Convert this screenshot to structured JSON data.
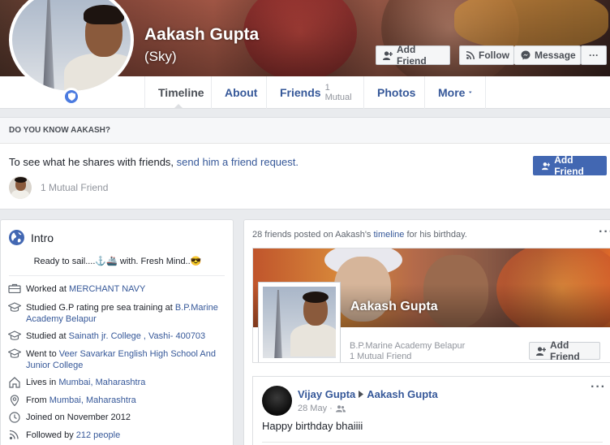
{
  "profile": {
    "name": "Aakash Gupta",
    "nickname": "(Sky)"
  },
  "header_actions": {
    "add_friend": "Add Friend",
    "follow": "Follow",
    "message": "Message",
    "more": "···"
  },
  "tabs": [
    {
      "label": "Timeline",
      "sub": ""
    },
    {
      "label": "About",
      "sub": ""
    },
    {
      "label": "Friends",
      "sub": "1 Mutual"
    },
    {
      "label": "Photos",
      "sub": ""
    },
    {
      "label": "More",
      "sub": ""
    }
  ],
  "know": {
    "header": "DO YOU KNOW AAKASH?",
    "text_prefix": "To see what he shares with friends, ",
    "text_link": "send him a friend request.",
    "add_friend": "Add Friend",
    "mutual": "1 Mutual Friend"
  },
  "intro": {
    "title": "Intro",
    "bio": "Ready to sail....⚓🚢 with. Fresh Mind..😎",
    "items": [
      {
        "prefix": "Worked at ",
        "link": "MERCHANT NAVY",
        "suffix": ""
      },
      {
        "prefix": "Studied G.P rating pre sea training at ",
        "link": "B.P.Marine Academy Belapur",
        "suffix": ""
      },
      {
        "prefix": "Studied at ",
        "link": "Sainath jr. College , Vashi- 400703",
        "suffix": ""
      },
      {
        "prefix": "Went to ",
        "link": "Veer Savarkar English High School And Junior College",
        "suffix": ""
      },
      {
        "prefix": "Lives in ",
        "link": "Mumbai, Maharashtra",
        "suffix": ""
      },
      {
        "prefix": "From ",
        "link": "Mumbai, Maharashtra",
        "suffix": ""
      },
      {
        "prefix": "Joined on November 2012",
        "link": "",
        "suffix": ""
      },
      {
        "prefix": "Followed by ",
        "link": "212 people",
        "suffix": ""
      }
    ]
  },
  "feed": {
    "header_prefix": "28 friends posted on Aakash's ",
    "header_link": "timeline",
    "header_suffix": " for his birthday.",
    "more": "···",
    "card": {
      "name": "Aakash Gupta",
      "school": "B.P.Marine Academy Belapur",
      "mutual": "1 Mutual Friend",
      "add_friend": "Add Friend"
    },
    "post": {
      "author": "Vijay Gupta",
      "target": "Aakash Gupta",
      "date": "28 May ·",
      "text": "Happy birthday bhaiiii",
      "more": "···"
    }
  },
  "colors": {
    "link": "#365899",
    "primary": "#4267b2",
    "page_bg": "#e9ebee"
  }
}
